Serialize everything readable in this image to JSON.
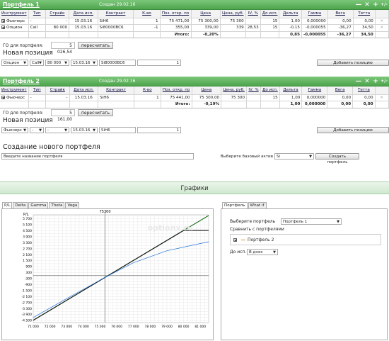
{
  "portfolio1": {
    "title": "Портфель 1",
    "created": "Создан 29.02.16",
    "columns": [
      "Инструмент",
      "Тип",
      "Страйк",
      "Дата исп.",
      "Контракт",
      "К-во",
      "Поз. откр. по",
      "Цена",
      "Цена, руб.",
      "IV, %",
      "До исп.",
      "Дельта",
      "Гамма",
      "Вега",
      "Тетта"
    ],
    "rows": [
      [
        "Фьючерс",
        "-",
        "-",
        "15.03.16",
        "SiH6",
        "1",
        "75 471,00",
        "75 300,00",
        "75 300",
        "",
        "15",
        "1,00",
        "0,000000",
        "0,00",
        "0,00"
      ],
      [
        "Опцион",
        "Call",
        "80 000",
        "15.03.16",
        "Si80000BC6",
        "-1",
        "355,00",
        "339,00",
        "339",
        "28,53",
        "15",
        "-0,15",
        "-0,000055",
        "-36,27",
        "34,50"
      ]
    ],
    "total_label": "Итого:",
    "total_pct": "-0,20%",
    "totals": [
      "0,85",
      "-0,000055",
      "-36,27",
      "34,50"
    ],
    "go_label": "ГО для портфеля:",
    "go_value": "5 026,54",
    "recalc": "пересчитать",
    "new_position": "Новая позиция",
    "new_row": [
      "Опцион",
      "Call",
      "80 000",
      "15.03.16",
      "Si80000BC6",
      "1"
    ],
    "add_position": "Добавить позицию"
  },
  "portfolio2": {
    "title": "Портфель 2",
    "created": "Создан 29.02.16",
    "columns": [
      "Инструмент",
      "Тип",
      "Страйк",
      "Дата исп.",
      "Контракт",
      "К-во",
      "Поз. откр. по",
      "Цена",
      "Цена, руб.",
      "IV, %",
      "До исп.",
      "Дельта",
      "Гамма",
      "Вега",
      "Тетта"
    ],
    "rows": [
      [
        "Фьючерс",
        "-",
        "-",
        "15.03.16",
        "SiH6",
        "1",
        "75 441,00",
        "75 300,00",
        "75 300",
        "",
        "15",
        "1,00",
        "0,000000",
        "0,00",
        "0,00"
      ]
    ],
    "total_label": "Итого:",
    "total_pct": "-0,19%",
    "totals": [
      "1,00",
      "0,000000",
      "0,00",
      "0,00"
    ],
    "go_label": "ГО для портфеля:",
    "go_value": "5 161,00",
    "recalc": "пересчитать",
    "new_position": "Новая позиция",
    "new_row": [
      "Фьючерс",
      "-",
      "-",
      "15.03.16",
      "SiH6",
      "1"
    ],
    "add_position": "Добавить позицию"
  },
  "create": {
    "title": "Создание нового портфеля",
    "name_placeholder": "Введите название портфеля",
    "base_label": "Выберите базовый актив",
    "base_value": "Si",
    "create_button": "Создать портфель"
  },
  "graphs": {
    "title": "Графики",
    "tabs": [
      "P/L",
      "Delta",
      "Gamma",
      "Theta",
      "Vega"
    ],
    "right_tabs": [
      "Портфель",
      "What if"
    ],
    "choose_label": "Выберите портфель",
    "choose_value": "Портфель 1",
    "compare_label": "Сравнить с портфелями",
    "compare_item": "Портфель 2",
    "until_label": "До исп.:",
    "until_value": "В днях",
    "watermark": "optionx.ru"
  },
  "chart_data": {
    "type": "line",
    "ylabel": "P/L",
    "marker_label": "75300",
    "x_ticks": [
      "71 000",
      "72 000",
      "73 000",
      "74 000",
      "75 000",
      "76 000",
      "77 000",
      "78 000",
      "79 000",
      "80 000",
      "81 000"
    ],
    "y_ticks": [
      "5 700",
      "5 100",
      "4 500",
      "3 900",
      "3 300",
      "2 700",
      "2 100",
      "1 500",
      "900",
      "300",
      "-300",
      "-900",
      "-1 500",
      "-2 100",
      "-2 700",
      "-3 300",
      "-3 900",
      "-4 500"
    ],
    "xlim": [
      71000,
      81500
    ],
    "ylim": [
      -4700,
      6100
    ],
    "marker_x": 75300,
    "series": [
      {
        "color": "#1d6f1d",
        "points": [
          [
            71000,
            -4470
          ],
          [
            81500,
            6030
          ]
        ]
      },
      {
        "color": "#1a1a1a",
        "points": [
          [
            71000,
            -4470
          ],
          [
            80000,
            4530
          ],
          [
            81500,
            4530
          ]
        ]
      },
      {
        "color": "#1f6fd8",
        "points": [
          [
            71000,
            -4200
          ],
          [
            73000,
            -2300
          ],
          [
            75300,
            -170
          ],
          [
            77000,
            1300
          ],
          [
            79000,
            2500
          ],
          [
            81500,
            3400
          ]
        ]
      }
    ]
  }
}
